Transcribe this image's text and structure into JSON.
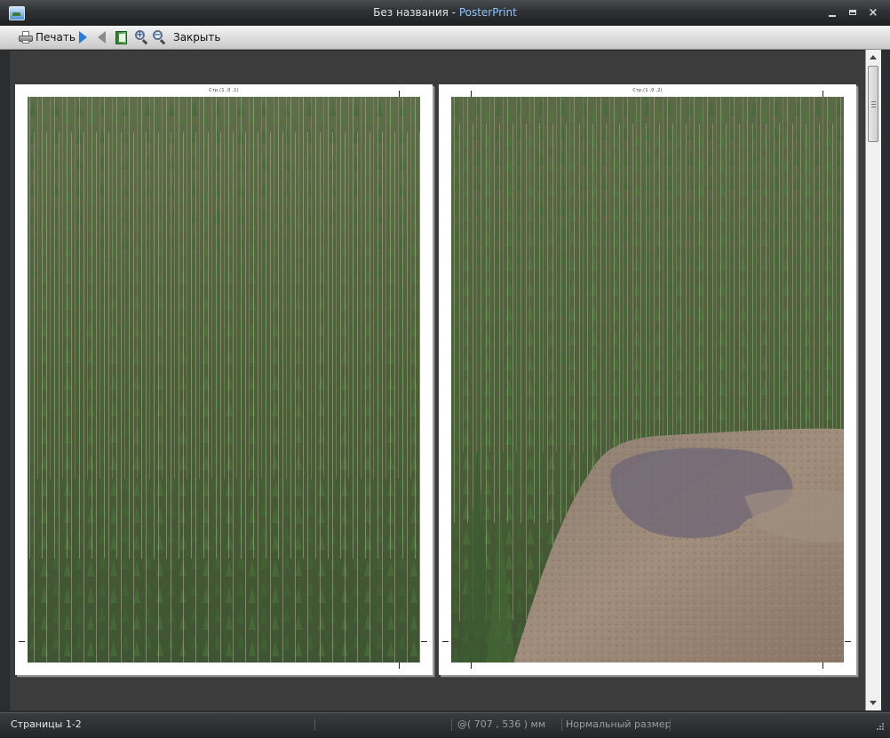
{
  "window": {
    "title_doc": "Без названия",
    "title_separator": " - ",
    "title_app": "PosterPrint",
    "controls": {
      "minimize": "minimize-icon",
      "maximize": "maximize-icon",
      "close": "×"
    }
  },
  "toolbar": {
    "print_label": "Печать",
    "close_label": "Закрыть",
    "icons": [
      "printer-icon",
      "next-page-icon",
      "prev-page-icon",
      "book-icon",
      "zoom-in-icon",
      "zoom-out-icon"
    ]
  },
  "pages": [
    {
      "label": "Стр.(1 ,0 ,1)"
    },
    {
      "label": "Стр.(1 ,0 ,2)"
    }
  ],
  "statusbar": {
    "pages": "Страницы 1-2",
    "coords": "@( 707 , 536 ) мм",
    "zoom": "Нормальный размер"
  },
  "colors": {
    "title_app": "#8ec4ff",
    "forest": "#4b6136",
    "rock": "#9a8777",
    "accent_arrow": "#2a7bd6"
  }
}
